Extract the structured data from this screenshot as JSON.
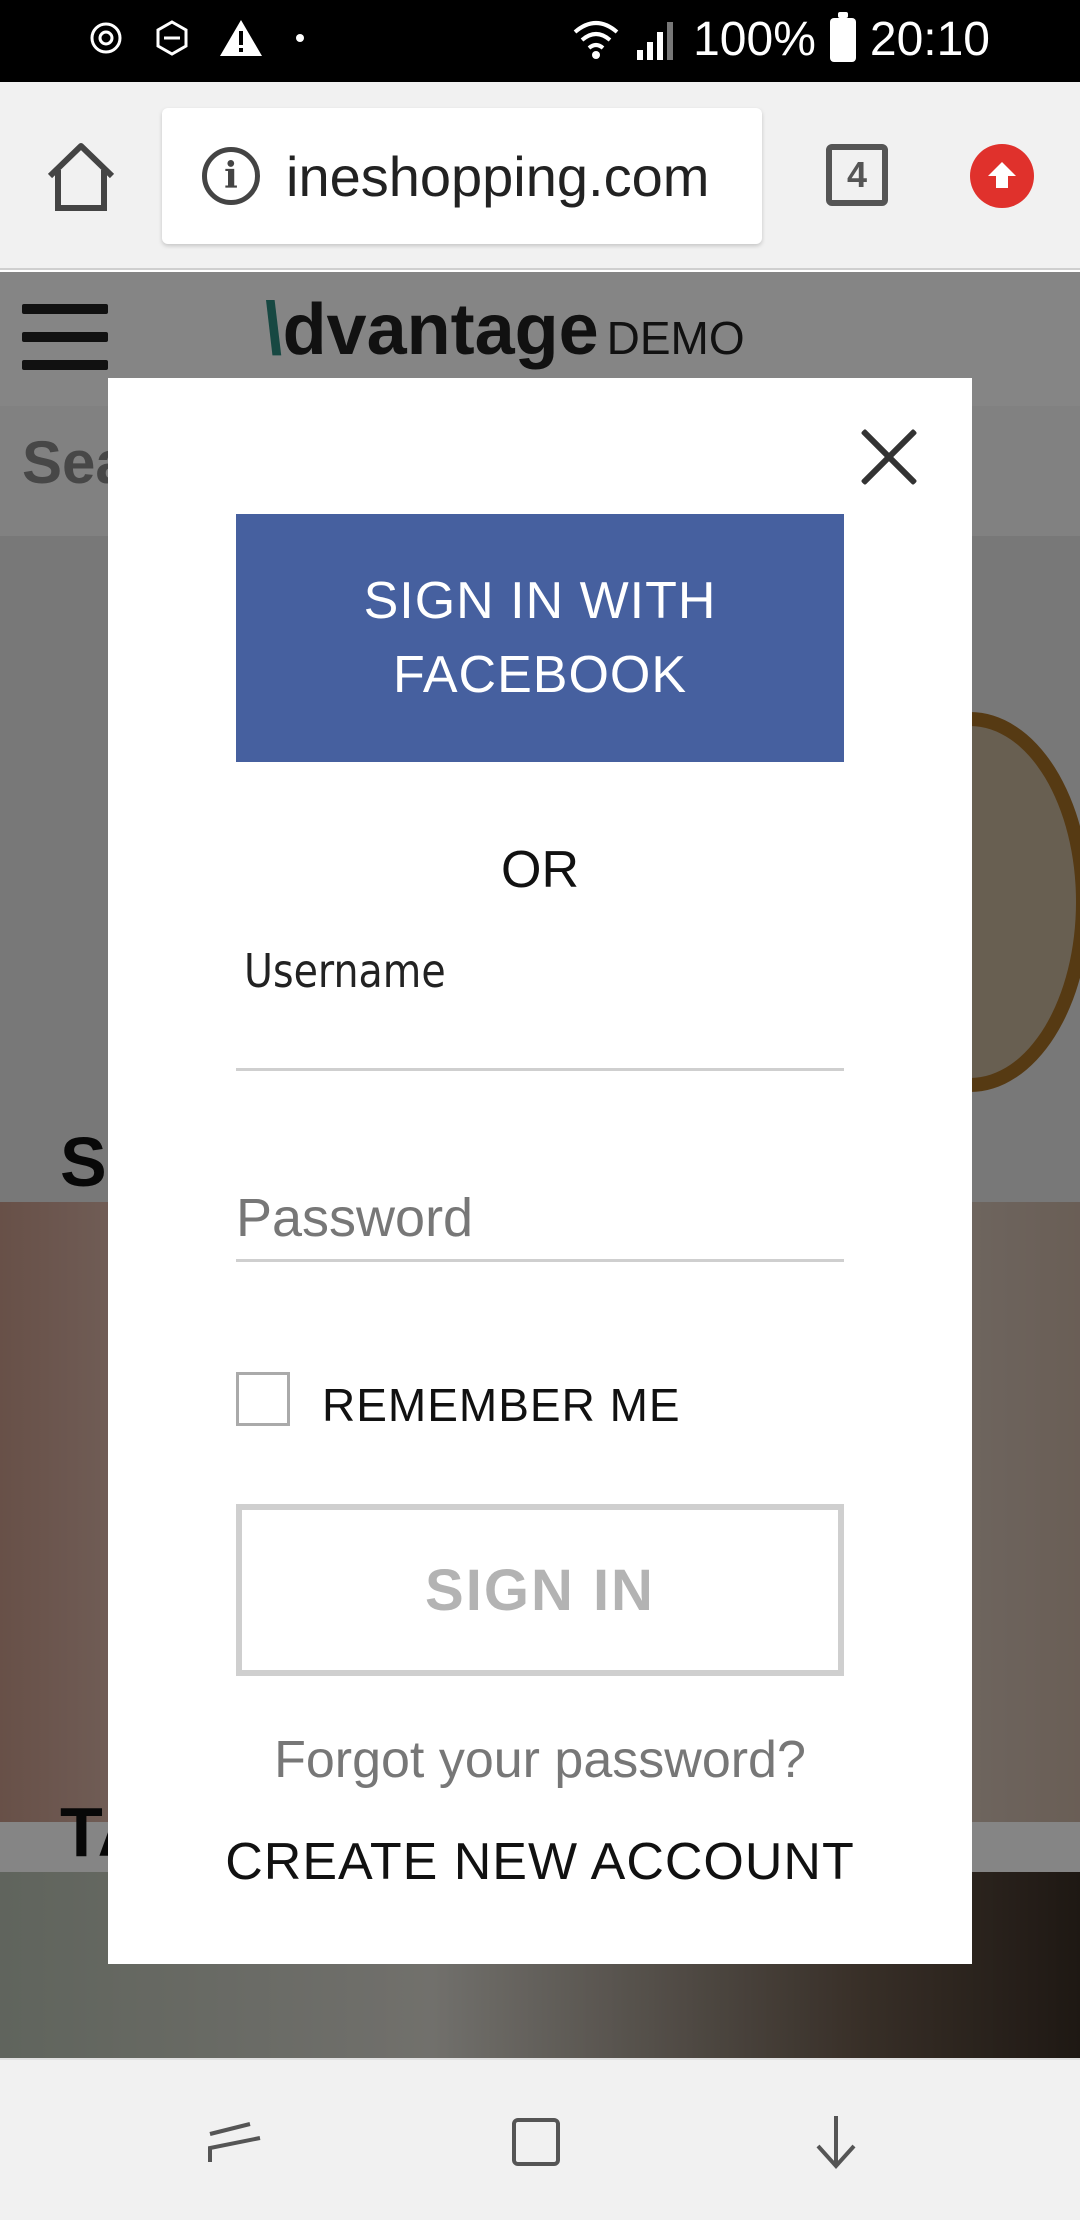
{
  "status_bar": {
    "battery": "100%",
    "time": "20:10"
  },
  "browser": {
    "url": "ineshopping.com",
    "tab_count": "4"
  },
  "page": {
    "logo_letter": "\\",
    "logo_text": "dvantage",
    "logo_suffix": "DEMO",
    "search_partial": "Sea",
    "section_1_partial": "S",
    "section_2_partial": "TA"
  },
  "modal": {
    "facebook_button": "SIGN IN WITH FACEBOOK",
    "or_text": "OR",
    "username_label": "Username",
    "password_placeholder": "Password",
    "remember_me": "REMEMBER ME",
    "sign_in_button": "SIGN IN",
    "forgot_password": "Forgot your password?",
    "create_account": "CREATE NEW ACCOUNT"
  },
  "icons": {
    "status_left": [
      "settings-icon",
      "hex-icon",
      "warning-icon",
      "dot-icon"
    ],
    "status_right": [
      "wifi-icon",
      "signal-icon",
      "battery-icon"
    ],
    "browser": [
      "home-icon",
      "info-icon",
      "tabs-icon",
      "update-icon"
    ],
    "nav": [
      "back-icon",
      "home-square-icon",
      "recent-down-icon"
    ]
  },
  "colors": {
    "facebook_blue": "#46609f",
    "update_red": "#e0312c",
    "logo_teal": "#2c8a7f"
  }
}
